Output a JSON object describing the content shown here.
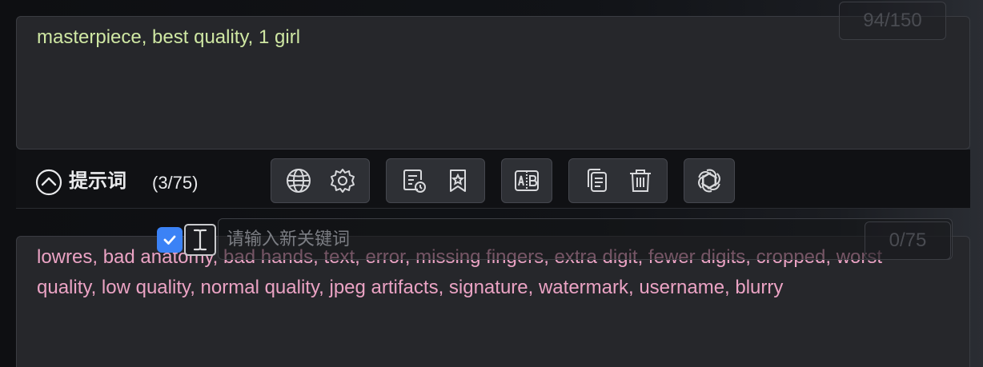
{
  "positive_prompt": {
    "text": "masterpiece, best quality, 1 girl",
    "counter": "94/150"
  },
  "toolbar": {
    "title": "提示词",
    "count": "(3/75)",
    "groups": [
      [
        "globe-icon",
        "gear-icon"
      ],
      [
        "history-icon",
        "bookmark-icon"
      ],
      [
        "translate-icon"
      ],
      [
        "copy-icon",
        "trash-icon"
      ],
      [
        "openai-icon"
      ]
    ]
  },
  "keyword_input": {
    "placeholder": "请输入新关键词",
    "value": "",
    "checked": true
  },
  "negative_prompt": {
    "text": "lowres, bad anatomy, bad hands, text, error, missing fingers, extra digit, fewer digits, cropped, worst quality, low quality, normal quality, jpeg artifacts, signature, watermark, username, blurry",
    "counter": "0/75"
  },
  "colors": {
    "positive_text": "#cfe7a3",
    "negative_text": "#eba3c4",
    "checkbox": "#3b82f6"
  }
}
